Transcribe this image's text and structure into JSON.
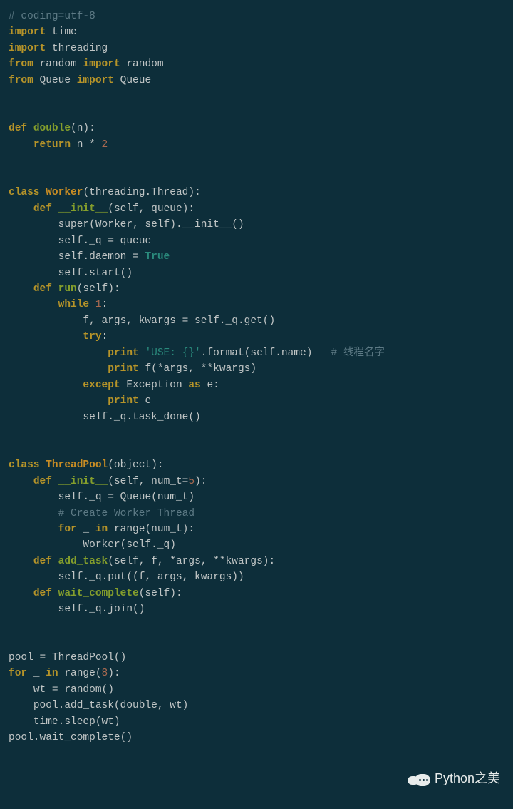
{
  "code": {
    "l01_cm": "# coding=utf-8",
    "l02_kw": "import",
    "l02_id": " time",
    "l03_kw": "import",
    "l03_id": " threading",
    "l04_kw1": "from",
    "l04_id1": " random ",
    "l04_kw2": "import",
    "l04_id2": " random",
    "l05_kw1": "from",
    "l05_id1": " Queue ",
    "l05_kw2": "import",
    "l05_id2": " Queue",
    "l06": "",
    "l07": "",
    "l08_kw": "def",
    "l08_sp": " ",
    "l08_fn": "double",
    "l08_rest": "(n):",
    "l09_ind": "    ",
    "l09_kw": "return",
    "l09_rest": " n * ",
    "l09_num": "2",
    "l10": "",
    "l11": "",
    "l12_kw": "class",
    "l12_sp": " ",
    "l12_cls": "Worker",
    "l12_rest": "(threading.Thread):",
    "l13_ind": "    ",
    "l13_kw": "def",
    "l13_sp": " ",
    "l13_fn": "__init__",
    "l13_rest": "(self, queue):",
    "l14": "        super(Worker, self).__init__()",
    "l15": "        self._q = queue",
    "l16a": "        self.daemon = ",
    "l16b": "True",
    "l17": "        self.start()",
    "l18_ind": "    ",
    "l18_kw": "def",
    "l18_sp": " ",
    "l18_fn": "run",
    "l18_rest": "(self):",
    "l19_ind": "        ",
    "l19_kw": "while",
    "l19_sp": " ",
    "l19_num": "1",
    "l19_rest": ":",
    "l20": "            f, args, kwargs = self._q.get()",
    "l21_ind": "            ",
    "l21_kw": "try",
    "l21_rest": ":",
    "l22_ind": "                ",
    "l22_kw": "print",
    "l22_sp": " ",
    "l22_str": "'USE: {}'",
    "l22_rest": ".format(self.name)   ",
    "l22_cm": "# 线程名字",
    "l23_ind": "                ",
    "l23_kw": "print",
    "l23_rest": " f(*args, **kwargs)",
    "l24_ind": "            ",
    "l24_kw1": "except",
    "l24_mid": " Exception ",
    "l24_kw2": "as",
    "l24_rest": " e:",
    "l25_ind": "                ",
    "l25_kw": "print",
    "l25_rest": " e",
    "l26": "            self._q.task_done()",
    "l27": "",
    "l28": "",
    "l29_kw": "class",
    "l29_sp": " ",
    "l29_cls": "ThreadPool",
    "l29_rest": "(object):",
    "l30_ind": "    ",
    "l30_kw": "def",
    "l30_sp": " ",
    "l30_fn": "__init__",
    "l30_rest": "(self, num_t=",
    "l30_num": "5",
    "l30_rest2": "):",
    "l31": "        self._q = Queue(num_t)",
    "l32_ind": "        ",
    "l32_cm": "# Create Worker Thread",
    "l33_ind": "        ",
    "l33_kw1": "for",
    "l33_mid": " _ ",
    "l33_kw2": "in",
    "l33_rest": " range(num_t):",
    "l34": "            Worker(self._q)",
    "l35_ind": "    ",
    "l35_kw": "def",
    "l35_sp": " ",
    "l35_fn": "add_task",
    "l35_rest": "(self, f, *args, **kwargs):",
    "l36": "        self._q.put((f, args, kwargs))",
    "l37_ind": "    ",
    "l37_kw": "def",
    "l37_sp": " ",
    "l37_fn": "wait_complete",
    "l37_rest": "(self):",
    "l38": "        self._q.join()",
    "l39": "",
    "l40": "",
    "l41": "pool = ThreadPool()",
    "l42_kw1": "for",
    "l42_mid": " _ ",
    "l42_kw2": "in",
    "l42_rest": " range(",
    "l42_num": "8",
    "l42_rest2": "):",
    "l43": "    wt = random()",
    "l44": "    pool.add_task(double, wt)",
    "l45": "    time.sleep(wt)",
    "l46": "pool.wait_complete()"
  },
  "watermark": {
    "text": "Python之美"
  }
}
